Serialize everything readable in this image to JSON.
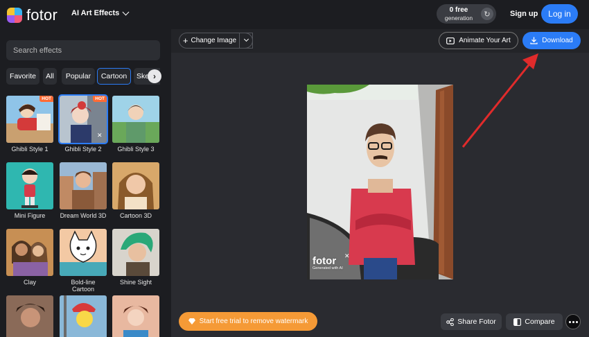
{
  "header": {
    "logo_text": "fotor",
    "menu_label": "AI Art Effects",
    "generation_count": "0 free",
    "generation_label": "generation",
    "signup_label": "Sign up",
    "login_label": "Log in"
  },
  "sidebar": {
    "search_placeholder": "Search effects",
    "tabs": [
      "Favorite",
      "All",
      "Popular",
      "Cartoon",
      "Sketch"
    ],
    "active_tab": "Cartoon",
    "hot_badge": "HOT",
    "effects": [
      {
        "label": "Ghibli Style 1",
        "hot": true
      },
      {
        "label": "Ghibli Style 2",
        "hot": true,
        "selected": true
      },
      {
        "label": "Ghibli Style 3"
      },
      {
        "label": "Mini Figure"
      },
      {
        "label": "Dream World 3D"
      },
      {
        "label": "Cartoon 3D"
      },
      {
        "label": "Clay"
      },
      {
        "label": "Bold-line Cartoon"
      },
      {
        "label": "Shine Sight"
      }
    ]
  },
  "toolbar": {
    "change_label": "Change Image",
    "animate_label": "Animate Your Art",
    "download_label": "Download"
  },
  "preview": {
    "watermark_logo": "fotor",
    "watermark_sub": "Generated with AI",
    "watermark_close": "✕"
  },
  "footer": {
    "trial_label": "Start free trial to remove watermark",
    "share_label": "Share Fotor",
    "compare_label": "Compare"
  },
  "colors": {
    "accent": "#2b7cf6",
    "trial": "#f59a36",
    "annotation_arrow": "#e02b2b"
  },
  "icons": {
    "generation": "refresh-icon",
    "change": "plus-icon",
    "animate": "animate-icon",
    "download": "download-icon",
    "trial": "gem-icon",
    "share": "share-icon",
    "compare": "compare-icon",
    "more": "more-dots-icon"
  }
}
